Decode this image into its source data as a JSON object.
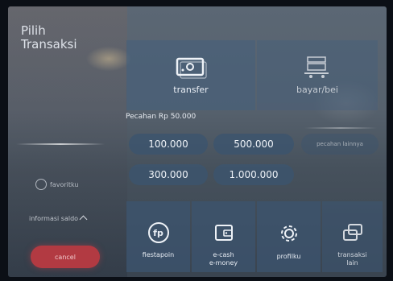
{
  "sidebar": {
    "title_line1": "Pilih",
    "title_line2": "Transaksi",
    "favorite_label": "favoritku",
    "info_saldo_label": "informasi saldo",
    "cancel_label": "cancel"
  },
  "tiles": {
    "transfer_label": "transfer",
    "bayar_label": "bayar/bei"
  },
  "denominations": {
    "heading": "Pecahan Rp 50.000",
    "options": [
      "100.000",
      "500.000",
      "300.000",
      "1.000.000"
    ],
    "other_label": "pecahan lainnya"
  },
  "bottom_tiles": [
    {
      "label": "fiestapoin"
    },
    {
      "label_line1": "e-cash",
      "label_line2": "e-money"
    },
    {
      "label": "profilku"
    },
    {
      "label_line1": "transaksi",
      "label_line2": "lain"
    }
  ],
  "colors": {
    "tile_bg": "#465f7a",
    "cancel_bg": "#b23a42"
  }
}
